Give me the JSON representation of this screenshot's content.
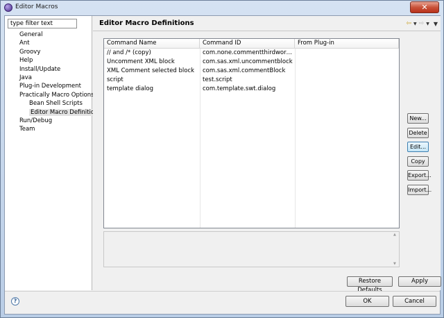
{
  "window": {
    "title": "Editor Macros",
    "close_label": "✕"
  },
  "sidebar": {
    "filter_placeholder": "type filter text",
    "items": [
      {
        "label": "General",
        "level": 0
      },
      {
        "label": "Ant",
        "level": 0
      },
      {
        "label": "Groovy",
        "level": 0
      },
      {
        "label": "Help",
        "level": 0
      },
      {
        "label": "Install/Update",
        "level": 0
      },
      {
        "label": "Java",
        "level": 0
      },
      {
        "label": "Plug-in Development",
        "level": 0
      },
      {
        "label": "Practically Macro Options",
        "level": 0
      },
      {
        "label": "Bean Shell Scripts",
        "level": 1
      },
      {
        "label": "Editor Macro Definitions",
        "level": 1
      },
      {
        "label": "Run/Debug",
        "level": 0
      },
      {
        "label": "Team",
        "level": 0
      }
    ]
  },
  "page": {
    "title": "Editor Macro Definitions",
    "table": {
      "columns": [
        "Command Name",
        "Command ID",
        "From Plug-in"
      ],
      "rows": [
        [
          "// and /* (copy)",
          "com.none.commentthirdword.co...",
          ""
        ],
        [
          "Uncomment XML block",
          "com.sas.xml.uncommentblock",
          ""
        ],
        [
          "XML Comment selected block",
          "com.sas.xml.commentBlock",
          ""
        ],
        [
          "script",
          "test.script",
          ""
        ],
        [
          "template dialog",
          "com.template.swt.dialog",
          ""
        ]
      ]
    },
    "side_buttons": {
      "new": "New...",
      "delete": "Delete",
      "edit": "Edit...",
      "copy": "Copy",
      "export": "Export...",
      "import": "Import..."
    },
    "restore_defaults": "Restore Defaults",
    "apply": "Apply"
  },
  "footer": {
    "ok": "OK",
    "cancel": "Cancel"
  },
  "icons": {
    "back": "back-arrow-icon",
    "forward": "forward-arrow-icon",
    "menu": "view-menu-icon",
    "help": "help-icon"
  },
  "colors": {
    "accent": "#3c7fb1",
    "title_close": "#c9533a"
  }
}
